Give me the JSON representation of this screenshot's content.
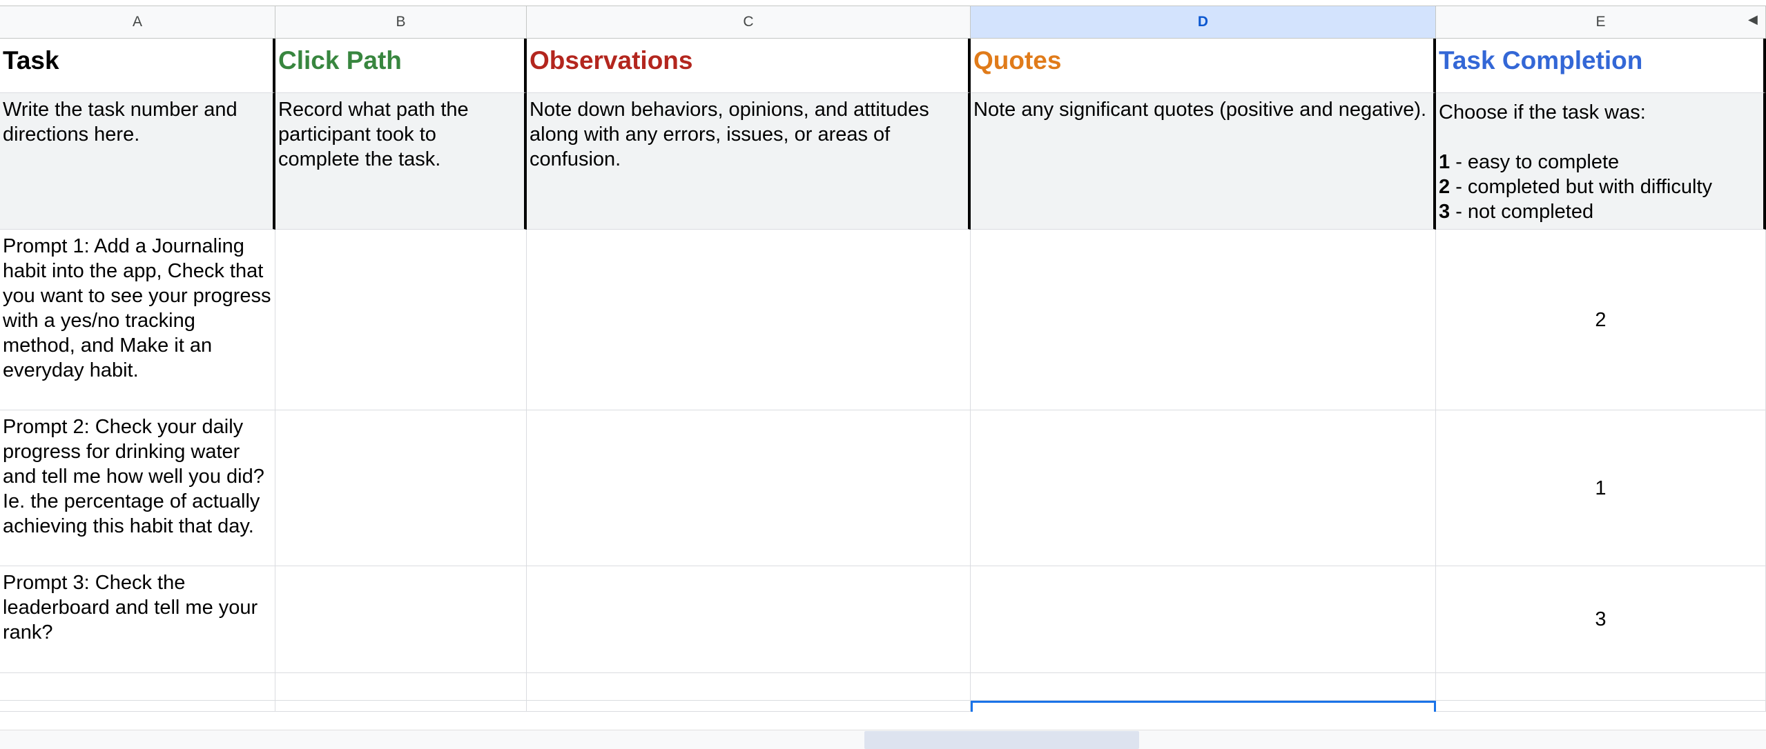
{
  "columns": [
    "A",
    "B",
    "C",
    "D",
    "E"
  ],
  "selected_column": "D",
  "headers": {
    "task": "Task",
    "click_path": "Click Path",
    "observations": "Observations",
    "quotes": "Quotes",
    "task_completion": "Task Completion"
  },
  "descriptions": {
    "task": "Write the task number and directions here.",
    "click_path": "Record what path the participant took to complete the task.",
    "observations": "Note down behaviors, opinions, and attitudes along with any errors, issues, or areas of confusion.",
    "quotes": "Note any significant quotes (positive and negative).",
    "task_completion_intro": "Choose if the task was:",
    "legend": [
      {
        "num": "1",
        "text": " - easy to complete"
      },
      {
        "num": "2",
        "text": " - completed but with difficulty"
      },
      {
        "num": "3",
        "text": " - not completed"
      }
    ]
  },
  "rows": [
    {
      "task": "Prompt 1: Add a Journaling habit into the app, Check that you want to see your progress with a yes/no tracking method, and Make it an everyday habit.",
      "click_path": "",
      "observations": "",
      "quotes": "",
      "completion": "2"
    },
    {
      "task": "Prompt 2: Check your daily progress for drinking water and tell me how well you did? Ie. the percentage of actually achieving this habit that day.",
      "click_path": "",
      "observations": "",
      "quotes": "",
      "completion": "1"
    },
    {
      "task": "Prompt 3: Check the leaderboard and tell me your rank?",
      "click_path": "",
      "observations": "",
      "quotes": "",
      "completion": "3"
    }
  ],
  "colors": {
    "green": "#38863f",
    "red": "#b3261e",
    "orange": "#e07b1a",
    "blue": "#3367d6",
    "selection": "#1a73e8"
  }
}
